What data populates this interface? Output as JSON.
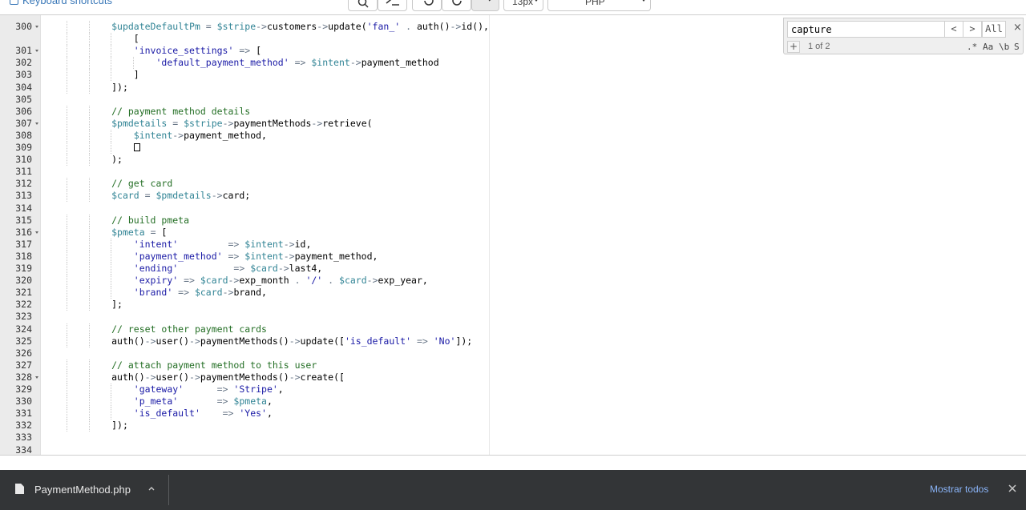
{
  "toolbar": {
    "keyboard_shortcuts": "Keyboard shortcuts",
    "font_size": "13px",
    "language": "PHP"
  },
  "editor": {
    "lines": [
      {
        "n": "300",
        "fold": true,
        "ind": 3,
        "t": [
          [
            "$updateDefaultPm",
            "v"
          ],
          [
            " = ",
            "o"
          ],
          [
            "$stripe",
            "v"
          ],
          [
            "->",
            "o"
          ],
          [
            "customers",
            "i"
          ],
          [
            "->",
            "o"
          ],
          [
            "update(",
            "i"
          ],
          [
            "'fan_'",
            "s"
          ],
          [
            " . ",
            "o"
          ],
          [
            "auth()",
            "i"
          ],
          [
            "->",
            "o"
          ],
          [
            "id(),",
            "i"
          ]
        ]
      },
      {
        "n": "",
        "fold": false,
        "ind": 4,
        "t": [
          [
            "[",
            "i"
          ]
        ]
      },
      {
        "n": "301",
        "fold": true,
        "ind": 4,
        "t": [
          [
            "'invoice_settings'",
            "s"
          ],
          [
            " => ",
            "o"
          ],
          [
            "[",
            "i"
          ]
        ]
      },
      {
        "n": "302",
        "fold": false,
        "ind": 5,
        "t": [
          [
            "'default_payment_method'",
            "s"
          ],
          [
            " => ",
            "o"
          ],
          [
            "$intent",
            "v"
          ],
          [
            "->",
            "o"
          ],
          [
            "payment_method",
            "i"
          ]
        ]
      },
      {
        "n": "303",
        "fold": false,
        "ind": 4,
        "t": [
          [
            "]",
            "i"
          ]
        ]
      },
      {
        "n": "304",
        "fold": false,
        "ind": 3,
        "t": [
          [
            "]);",
            "i"
          ]
        ]
      },
      {
        "n": "305",
        "fold": false,
        "ind": 0,
        "t": []
      },
      {
        "n": "306",
        "fold": false,
        "ind": 3,
        "t": [
          [
            "// payment method details",
            "c"
          ]
        ]
      },
      {
        "n": "307",
        "fold": true,
        "ind": 3,
        "t": [
          [
            "$pmdetails",
            "v"
          ],
          [
            " = ",
            "o"
          ],
          [
            "$stripe",
            "v"
          ],
          [
            "->",
            "o"
          ],
          [
            "paymentMethods",
            "i"
          ],
          [
            "->",
            "o"
          ],
          [
            "retrieve(",
            "i"
          ]
        ]
      },
      {
        "n": "308",
        "fold": false,
        "ind": 4,
        "t": [
          [
            "$intent",
            "v"
          ],
          [
            "->",
            "o"
          ],
          [
            "payment_method,",
            "i"
          ]
        ]
      },
      {
        "n": "309",
        "fold": false,
        "ind": 4,
        "t": [
          [
            "",
            "box"
          ]
        ]
      },
      {
        "n": "310",
        "fold": false,
        "ind": 3,
        "t": [
          [
            ");",
            "i"
          ]
        ]
      },
      {
        "n": "311",
        "fold": false,
        "ind": 0,
        "t": []
      },
      {
        "n": "312",
        "fold": false,
        "ind": 3,
        "t": [
          [
            "// get card",
            "c"
          ]
        ]
      },
      {
        "n": "313",
        "fold": false,
        "ind": 3,
        "t": [
          [
            "$card",
            "v"
          ],
          [
            " = ",
            "o"
          ],
          [
            "$pmdetails",
            "v"
          ],
          [
            "->",
            "o"
          ],
          [
            "card;",
            "i"
          ]
        ]
      },
      {
        "n": "314",
        "fold": false,
        "ind": 0,
        "t": []
      },
      {
        "n": "315",
        "fold": false,
        "ind": 3,
        "t": [
          [
            "// build pmeta",
            "c"
          ]
        ]
      },
      {
        "n": "316",
        "fold": true,
        "ind": 3,
        "t": [
          [
            "$pmeta",
            "v"
          ],
          [
            " = ",
            "o"
          ],
          [
            "[",
            "i"
          ]
        ]
      },
      {
        "n": "317",
        "fold": false,
        "ind": 4,
        "t": [
          [
            "'intent'",
            "s"
          ],
          [
            "         => ",
            "o"
          ],
          [
            "$intent",
            "v"
          ],
          [
            "->",
            "o"
          ],
          [
            "id,",
            "i"
          ]
        ]
      },
      {
        "n": "318",
        "fold": false,
        "ind": 4,
        "t": [
          [
            "'payment_method'",
            "s"
          ],
          [
            " => ",
            "o"
          ],
          [
            "$intent",
            "v"
          ],
          [
            "->",
            "o"
          ],
          [
            "payment_method,",
            "i"
          ]
        ]
      },
      {
        "n": "319",
        "fold": false,
        "ind": 4,
        "t": [
          [
            "'ending'",
            "s"
          ],
          [
            "          => ",
            "o"
          ],
          [
            "$card",
            "v"
          ],
          [
            "->",
            "o"
          ],
          [
            "last4,",
            "i"
          ]
        ]
      },
      {
        "n": "320",
        "fold": false,
        "ind": 4,
        "t": [
          [
            "'expiry'",
            "s"
          ],
          [
            " => ",
            "o"
          ],
          [
            "$card",
            "v"
          ],
          [
            "->",
            "o"
          ],
          [
            "exp_month",
            "i"
          ],
          [
            " . ",
            "o"
          ],
          [
            "'/'",
            "s"
          ],
          [
            " . ",
            "o"
          ],
          [
            "$card",
            "v"
          ],
          [
            "->",
            "o"
          ],
          [
            "exp_year,",
            "i"
          ]
        ]
      },
      {
        "n": "321",
        "fold": false,
        "ind": 4,
        "t": [
          [
            "'brand'",
            "s"
          ],
          [
            " => ",
            "o"
          ],
          [
            "$card",
            "v"
          ],
          [
            "->",
            "o"
          ],
          [
            "brand,",
            "i"
          ]
        ]
      },
      {
        "n": "322",
        "fold": false,
        "ind": 3,
        "t": [
          [
            "];",
            "i"
          ]
        ]
      },
      {
        "n": "323",
        "fold": false,
        "ind": 0,
        "t": []
      },
      {
        "n": "324",
        "fold": false,
        "ind": 3,
        "t": [
          [
            "// reset other payment cards",
            "c"
          ]
        ]
      },
      {
        "n": "325",
        "fold": false,
        "ind": 3,
        "t": [
          [
            "auth()",
            "i"
          ],
          [
            "->",
            "o"
          ],
          [
            "user()",
            "i"
          ],
          [
            "->",
            "o"
          ],
          [
            "paymentMethods()",
            "i"
          ],
          [
            "->",
            "o"
          ],
          [
            "update([",
            "i"
          ],
          [
            "'is_default'",
            "s"
          ],
          [
            " => ",
            "o"
          ],
          [
            "'No'",
            "s"
          ],
          [
            "]);",
            "i"
          ]
        ]
      },
      {
        "n": "326",
        "fold": false,
        "ind": 0,
        "t": []
      },
      {
        "n": "327",
        "fold": false,
        "ind": 3,
        "t": [
          [
            "// attach payment method to this user",
            "c"
          ]
        ]
      },
      {
        "n": "328",
        "fold": true,
        "ind": 3,
        "t": [
          [
            "auth()",
            "i"
          ],
          [
            "->",
            "o"
          ],
          [
            "user()",
            "i"
          ],
          [
            "->",
            "o"
          ],
          [
            "paymentMethods()",
            "i"
          ],
          [
            "->",
            "o"
          ],
          [
            "create([",
            "i"
          ]
        ]
      },
      {
        "n": "329",
        "fold": false,
        "ind": 4,
        "t": [
          [
            "'gateway'",
            "s"
          ],
          [
            "      => ",
            "o"
          ],
          [
            "'Stripe'",
            "s"
          ],
          [
            ",",
            "i"
          ]
        ]
      },
      {
        "n": "330",
        "fold": false,
        "ind": 4,
        "t": [
          [
            "'p_meta'",
            "s"
          ],
          [
            "       => ",
            "o"
          ],
          [
            "$pmeta",
            "v"
          ],
          [
            ",",
            "i"
          ]
        ]
      },
      {
        "n": "331",
        "fold": false,
        "ind": 4,
        "t": [
          [
            "'is_default'",
            "s"
          ],
          [
            "    => ",
            "o"
          ],
          [
            "'Yes'",
            "s"
          ],
          [
            ",",
            "i"
          ]
        ]
      },
      {
        "n": "332",
        "fold": false,
        "ind": 3,
        "t": [
          [
            "]);",
            "i"
          ]
        ]
      },
      {
        "n": "333",
        "fold": false,
        "ind": 0,
        "t": []
      },
      {
        "n": "334",
        "fold": false,
        "ind": 0,
        "t": []
      }
    ]
  },
  "search": {
    "query": "capture",
    "prev_label": "<",
    "next_label": ">",
    "all_label": "All",
    "close_label": "×",
    "add_label": "+",
    "count": "1 of 2",
    "regex_label": ".*",
    "case_label": "Aa",
    "word_label": "\\b",
    "selection_label": "S"
  },
  "download_bar": {
    "file_name": "PaymentMethod.php",
    "show_all": "Mostrar todos"
  },
  "colors": {
    "variable": "#318495",
    "string": "#1a1aa6",
    "comment": "#236e24",
    "operator": "#687687",
    "download_bar_bg": "#333537",
    "link": "#8ab4f8"
  }
}
